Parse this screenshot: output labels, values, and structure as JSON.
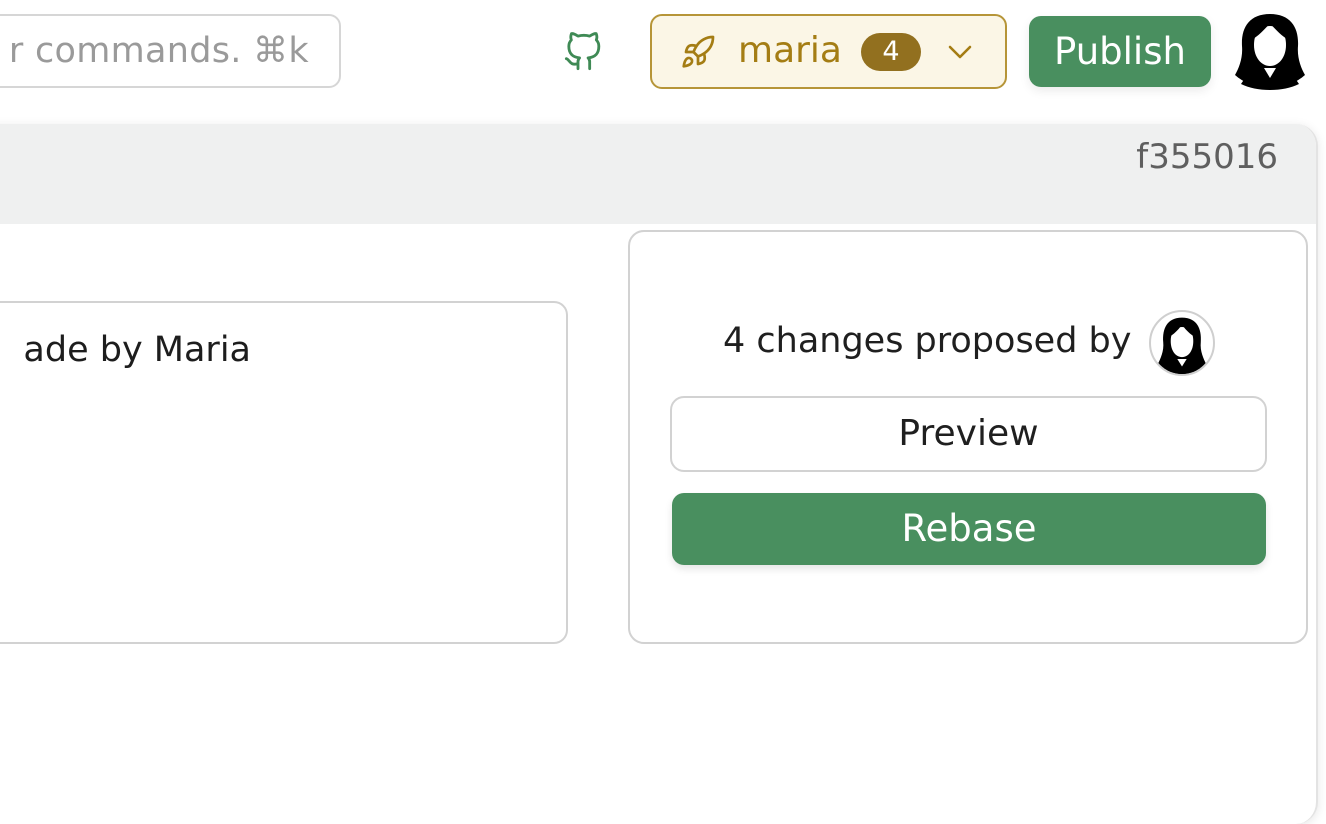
{
  "search": {
    "placeholder_text": "r commands.  ⌘k"
  },
  "branch": {
    "name": "maria",
    "count": "4"
  },
  "header": {
    "publish_label": "Publish"
  },
  "commit": {
    "hash": "f355016"
  },
  "description": {
    "text": "ade by Maria"
  },
  "changes": {
    "proposed_text": "4 changes proposed by",
    "preview_label": "Preview",
    "rebase_label": "Rebase"
  },
  "icons": {
    "github": "github-icon",
    "rocket": "rocket-icon",
    "chevron": "chevron-down-icon",
    "avatar": "avatar-icon"
  },
  "colors": {
    "accent_green": "#498f5f",
    "branch_bg": "#fbf6e6",
    "branch_border": "#b69538",
    "branch_text": "#a47d14",
    "badge_bg": "#92701f",
    "header_gray": "#eff0f0"
  }
}
